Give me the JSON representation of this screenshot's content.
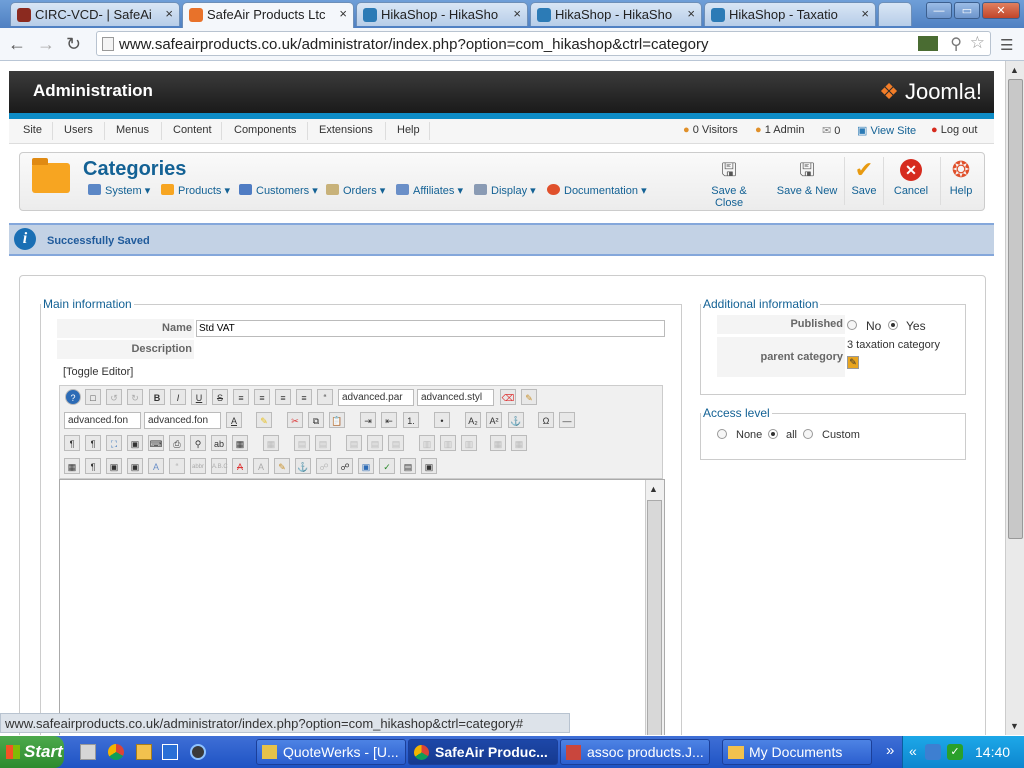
{
  "browser": {
    "tabs": [
      {
        "label": "CIRC-VCD- | SafeAi",
        "color": "#8b2a1f"
      },
      {
        "label": "SafeAir Products Ltc",
        "color": "#e8722a",
        "active": true
      },
      {
        "label": "HikaShop - HikaSho",
        "color": "#2c7bb6"
      },
      {
        "label": "HikaShop - HikaSho",
        "color": "#2c7bb6"
      },
      {
        "label": "HikaShop - Taxatio",
        "color": "#2c7bb6"
      }
    ],
    "close_glyph": "×",
    "window_buttons": [
      "—",
      "▭",
      "✕"
    ],
    "url": "www.safeairproducts.co.uk/administrator/index.php?option=com_hikashop&ctrl=category",
    "status_url": "www.safeairproducts.co.uk/administrator/index.php?option=com_hikashop&ctrl=category#"
  },
  "header": {
    "title": "Administration",
    "logo_text": "Joomla!"
  },
  "menu": [
    "Site",
    "Users",
    "Menus",
    "Content",
    "Components",
    "Extensions",
    "Help"
  ],
  "status_items": {
    "visitors": "0 Visitors",
    "admins": "1 Admin",
    "messages": "0",
    "view_site": "View Site",
    "logout": "Log out"
  },
  "page_title": "Categories",
  "submenu": [
    {
      "label": "System",
      "color": "#5b87c6"
    },
    {
      "label": "Products",
      "color": "#f7a521"
    },
    {
      "label": "Customers",
      "color": "#4f7cc3"
    },
    {
      "label": "Orders",
      "color": "#c8b27a"
    },
    {
      "label": "Affiliates",
      "color": "#6a8fc8"
    },
    {
      "label": "Display",
      "color": "#8a9bb4"
    },
    {
      "label": "Documentation",
      "color": "#e0502b"
    }
  ],
  "dropdown_glyph": "▾",
  "toolbar": [
    {
      "label": "Save & Close",
      "icon": "save-close-icon"
    },
    {
      "label": "Save & New",
      "icon": "save-new-icon"
    },
    {
      "label": "Save",
      "icon": "check-icon"
    },
    {
      "label": "Cancel",
      "icon": "cancel-icon"
    },
    {
      "label": "Help",
      "icon": "help-icon"
    }
  ],
  "message": "Successfully Saved",
  "main_info": {
    "legend": "Main information",
    "name_label": "Name",
    "name_value": "Std VAT",
    "description_label": "Description",
    "toggle_editor": "[Toggle Editor]",
    "editor_selects": [
      "advanced.par",
      "advanced.styl",
      "advanced.fon",
      "advanced.fon"
    ]
  },
  "additional_info": {
    "legend": "Additional information",
    "published_label": "Published",
    "no": "No",
    "yes": "Yes",
    "published_value": "Yes",
    "parent_label": "parent category",
    "parent_value": "3 taxation category"
  },
  "access": {
    "legend": "Access level",
    "options": [
      "None",
      "all",
      "Custom"
    ],
    "selected": "all"
  },
  "taskbar": {
    "start": "Start",
    "items": [
      "QuoteWerks - [U...",
      "SafeAir Produc...",
      "assoc products.J...",
      "My Documents"
    ],
    "active_index": 1,
    "time": "14:40"
  }
}
